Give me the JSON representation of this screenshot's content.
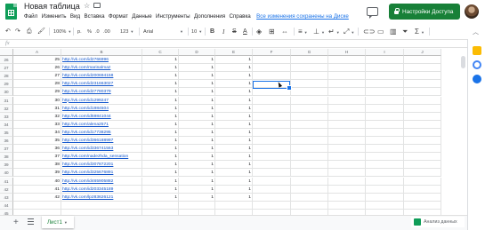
{
  "app": {
    "title": "Новая таблица",
    "menu": [
      "Файл",
      "Изменить",
      "Вид",
      "Вставка",
      "Формат",
      "Данные",
      "Инструменты",
      "Дополнения",
      "Справка"
    ],
    "saved_status": "Все изменения сохранены на Диске",
    "share_label": "Настройки Доступа"
  },
  "toolbar": {
    "zoom": "100%",
    "currency": "р.",
    "percent": "%",
    "decimal_less": ".0",
    "decimal_more": ".00",
    "number_format": "123",
    "font": "Arial",
    "font_size": "10",
    "bold": "B",
    "italic": "I",
    "strikethrough": "S",
    "text_color": "A"
  },
  "formula_bar": {
    "fx": "fx"
  },
  "grid": {
    "columns": [
      "A",
      "B",
      "C",
      "D",
      "E",
      "F",
      "G",
      "H",
      "I",
      "J"
    ],
    "rows": [
      {
        "num": "26",
        "a": "25",
        "b": "http://vk.com/id2766996",
        "c": "1",
        "d": "1",
        "e": "1"
      },
      {
        "num": "27",
        "a": "26",
        "b": "http://vk.com/marinalmaz",
        "c": "1",
        "d": "1",
        "e": "1"
      },
      {
        "num": "28",
        "a": "27",
        "b": "http://vk.com/id200694158",
        "c": "1",
        "d": "1",
        "e": "1"
      },
      {
        "num": "29",
        "a": "28",
        "b": "http://vk.com/id231663027",
        "c": "1",
        "d": "1",
        "e": "1"
      },
      {
        "num": "30",
        "a": "29",
        "b": "http://vk.com/id27780379",
        "c": "1",
        "d": "1",
        "e": "1"
      },
      {
        "num": "31",
        "a": "30",
        "b": "http://vk.com/id1299247",
        "c": "1",
        "d": "1",
        "e": "1"
      },
      {
        "num": "32",
        "a": "31",
        "b": "http://vk.com/id1984504",
        "c": "1",
        "d": "1",
        "e": "1"
      },
      {
        "num": "33",
        "a": "32",
        "b": "http://vk.com/id59841044",
        "c": "1",
        "d": "1",
        "e": "1"
      },
      {
        "num": "34",
        "a": "33",
        "b": "http://vk.com/alena2571",
        "c": "1",
        "d": "1",
        "e": "1"
      },
      {
        "num": "35",
        "a": "34",
        "b": "http://vk.com/id17738295",
        "c": "1",
        "d": "1",
        "e": "1"
      },
      {
        "num": "36",
        "a": "35",
        "b": "http://vk.com/id366188997",
        "c": "1",
        "d": "1",
        "e": "1"
      },
      {
        "num": "37",
        "a": "36",
        "b": "http://vk.com/id336741563",
        "c": "1",
        "d": "1",
        "e": "1"
      },
      {
        "num": "38",
        "a": "37",
        "b": "http://vk.com/nadezhda_sensation",
        "c": "1",
        "d": "1",
        "e": "1"
      },
      {
        "num": "39",
        "a": "38",
        "b": "http://vk.com/id307872201",
        "c": "1",
        "d": "1",
        "e": "1"
      },
      {
        "num": "40",
        "a": "39",
        "b": "http://vk.com/id325676891",
        "c": "1",
        "d": "1",
        "e": "1"
      },
      {
        "num": "41",
        "a": "40",
        "b": "http://vk.com/id465905882",
        "c": "1",
        "d": "1",
        "e": "1"
      },
      {
        "num": "42",
        "a": "41",
        "b": "http://vk.com/id203345189",
        "c": "1",
        "d": "1",
        "e": "1"
      },
      {
        "num": "43",
        "a": "42",
        "b": "http://vk.com/lp283626121",
        "c": "1",
        "d": "1",
        "e": "1"
      },
      {
        "num": "44",
        "a": "",
        "b": "",
        "c": "",
        "d": "",
        "e": ""
      },
      {
        "num": "45",
        "a": "",
        "b": "",
        "c": "",
        "d": "",
        "e": ""
      },
      {
        "num": "46",
        "a": "",
        "b": "",
        "c": "",
        "d": "",
        "e": ""
      }
    ]
  },
  "sheets": {
    "tabs": [
      "Лист1"
    ],
    "explore_label": "Анализ данных"
  },
  "colors": {
    "share_button": "#188038",
    "selection": "#1a73e8",
    "link": "#1155cc",
    "sheet_tab_text": "#188038"
  }
}
